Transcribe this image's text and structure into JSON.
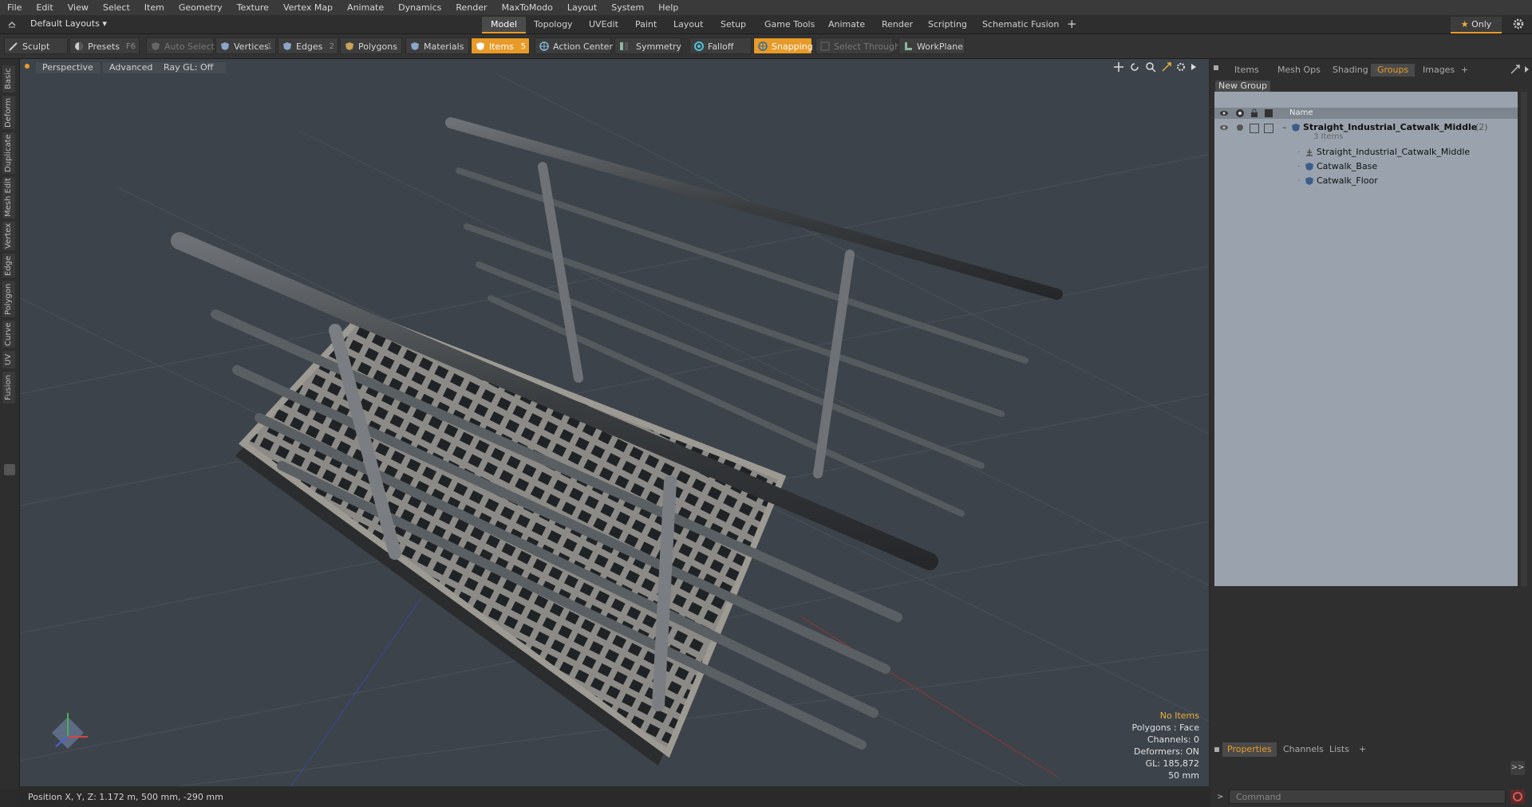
{
  "menubar": [
    "File",
    "Edit",
    "View",
    "Select",
    "Item",
    "Geometry",
    "Texture",
    "Vertex Map",
    "Animate",
    "Dynamics",
    "Render",
    "MaxToModo",
    "Layout",
    "System",
    "Help"
  ],
  "layout": {
    "dropdown": "Default Layouts",
    "tabs": [
      "Model",
      "Topology",
      "UVEdit",
      "Paint",
      "Layout",
      "Setup",
      "Game Tools",
      "Animate",
      "Render",
      "Scripting",
      "Schematic Fusion"
    ],
    "active_tab": "Model",
    "add": "+",
    "only_label": "Only"
  },
  "toolbar": {
    "sculpt": "Sculpt",
    "presets": "Presets",
    "presets_key": "F6",
    "auto_select": "Auto Select",
    "vertices": "Vertices",
    "vertices_count": "1",
    "edges": "Edges",
    "edges_count": "2",
    "polygons": "Polygons",
    "materials": "Materials",
    "items": "Items",
    "items_count": "5",
    "action_center": "Action Center",
    "symmetry": "Symmetry",
    "falloff": "Falloff",
    "snapping": "Snapping",
    "select_through": "Select Through",
    "workplane": "WorkPlane"
  },
  "left_tabs": [
    "Basic",
    "Deform",
    "Duplicate",
    "Mesh Edit",
    "Vertex",
    "Edge",
    "Polygon",
    "Curve",
    "UV",
    "Fusion"
  ],
  "viewport": {
    "view_mode": "Perspective",
    "shading": "Advanced",
    "raygl": "Ray GL: Off",
    "info": {
      "items": "No Items",
      "polygons": "Polygons : Face",
      "channels": "Channels: 0",
      "deformers": "Deformers: ON",
      "gl": "GL: 185,872",
      "scale": "50 mm"
    }
  },
  "status": {
    "position": "Position X, Y, Z:  1.172 m, 500 mm, -290 mm"
  },
  "right_panel": {
    "tabs": [
      "Items",
      "Mesh Ops",
      "Shading",
      "Groups",
      "Images"
    ],
    "active_tab": "Groups",
    "new_group": "New Group",
    "col_name": "Name",
    "group": {
      "name": "Straight_Industrial_Catwalk_Middle",
      "count": "(2)",
      "sub": "3 Items",
      "children": [
        "Straight_Industrial_Catwalk_Middle",
        "Catwalk_Base",
        "Catwalk_Floor"
      ]
    },
    "bottom_tabs": [
      "Properties",
      "Channels",
      "Lists"
    ],
    "active_bottom_tab": "Properties",
    "command_placeholder": "Command"
  },
  "colors": {
    "accent": "#e89b28",
    "viewport_bg": "#3d434a",
    "panel_bg": "#9aa3ad"
  }
}
